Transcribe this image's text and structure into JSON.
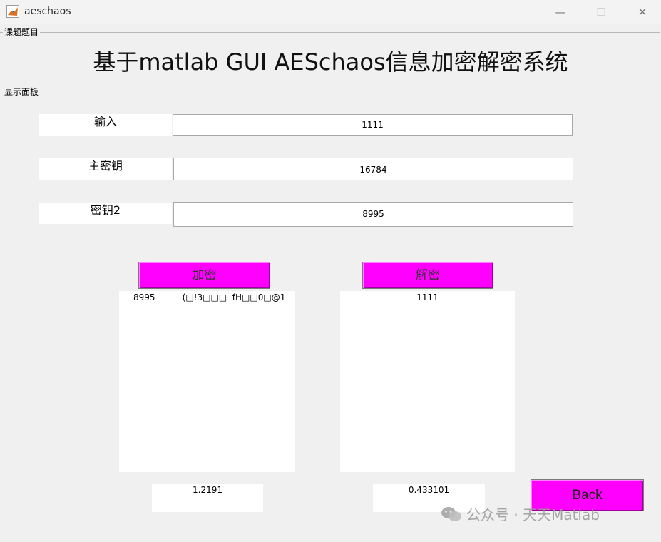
{
  "window": {
    "title": "aeschaos",
    "min_symbol": "—",
    "max_symbol": "☐",
    "close_symbol": "✕"
  },
  "panel_title": {
    "label": "课题题目",
    "heading": "基于matlab GUI AESchaos信息加密解密系统"
  },
  "panel_display": {
    "label": "显示面板"
  },
  "form": {
    "input_label": "输入",
    "input_value": "1111",
    "master_key_label": "主密钥",
    "master_key_value": "16784",
    "key2_label": "密钥2",
    "key2_value": "8995"
  },
  "buttons": {
    "encrypt": "加密",
    "decrypt": "解密",
    "back": "Back"
  },
  "outputs": {
    "encrypt_list_row": "8995          (□!3□□□  fH□□0□@1",
    "decrypt_list_row": "1111",
    "encrypt_value": "1.2191",
    "decrypt_value": "0.433101"
  },
  "watermark": {
    "text": "公众号 · 天天Matlab",
    "icon": "wechat-icon"
  },
  "colors": {
    "button": "#ff00ff",
    "background": "#f0f0f0"
  }
}
